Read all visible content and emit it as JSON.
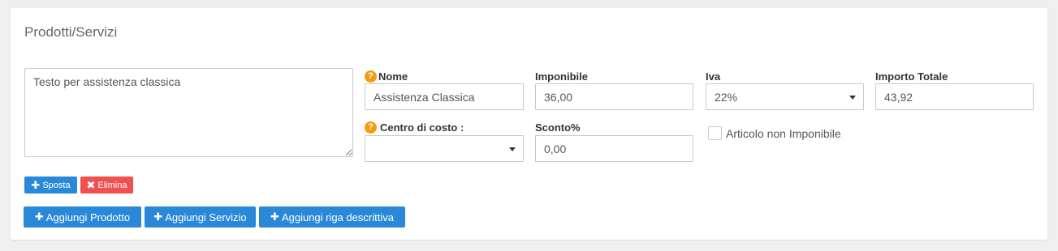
{
  "panel": {
    "title": "Prodotti/Servizi"
  },
  "row": {
    "description": "Testo per assistenza classica",
    "nome": {
      "label": "Nome",
      "value": "Assistenza Classica"
    },
    "imponibile": {
      "label": "Imponibile",
      "value": "36,00"
    },
    "iva": {
      "label": "Iva",
      "value": "22%"
    },
    "importo_totale": {
      "label": "Importo Totale",
      "value": "43,92"
    },
    "centro_di_costo": {
      "label": "Centro di costo :",
      "value": ""
    },
    "sconto": {
      "label": "Sconto%",
      "value": "0,00"
    },
    "non_imponibile": {
      "label": "Articolo non Imponibile",
      "checked": false
    },
    "help_glyph": "?",
    "actions": {
      "sposta": "Sposta",
      "elimina": "Elimina"
    }
  },
  "footer_actions": {
    "add_product": "Aggiungi Prodotto",
    "add_service": "Aggiungi Servizio",
    "add_description_row": "Aggiungi riga descrittiva"
  },
  "icons": {
    "move": "move-icon",
    "delete": "times-icon",
    "add": "plus-icon",
    "help": "question-circle-icon",
    "dropdown": "caret-down-icon"
  },
  "colors": {
    "primary": "#2989d8",
    "danger": "#f05050",
    "help": "#f39c12"
  }
}
